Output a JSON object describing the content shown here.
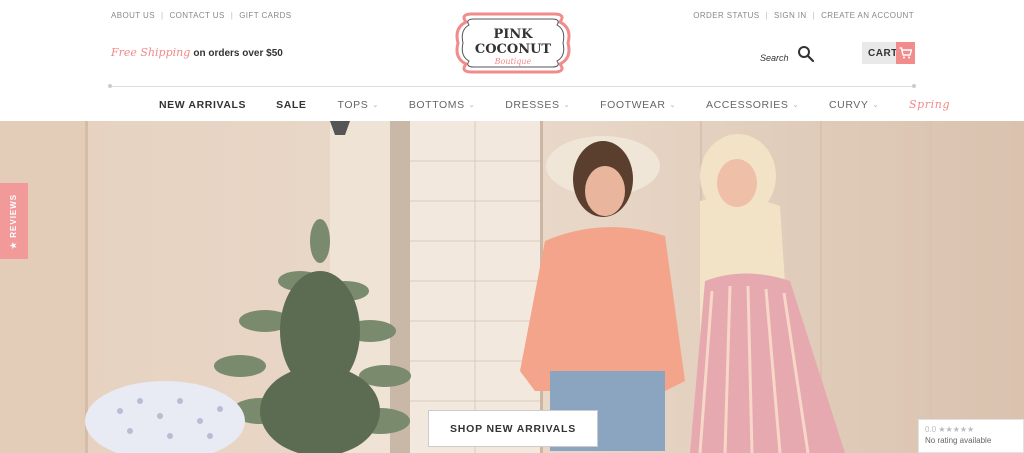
{
  "utility_left": [
    "ABOUT US",
    "CONTACT US",
    "GIFT CARDS"
  ],
  "utility_right": [
    "ORDER STATUS",
    "SIGN IN",
    "CREATE AN ACCOUNT"
  ],
  "logo": {
    "line1": "PINK",
    "line2": "COCONUT",
    "line3": "Boutique",
    "accent": "#f28b8b"
  },
  "shipping": {
    "free": "Free Shipping",
    "rest": "on orders over $50"
  },
  "search": {
    "label": "Search",
    "icon": "search-icon"
  },
  "cart": {
    "label": "CART",
    "icon": "cart-icon"
  },
  "nav": [
    {
      "label": "NEW ARRIVALS",
      "dropdown": false,
      "style": "bold"
    },
    {
      "label": "SALE",
      "dropdown": false,
      "style": "bold"
    },
    {
      "label": "TOPS",
      "dropdown": true,
      "style": "reg"
    },
    {
      "label": "BOTTOMS",
      "dropdown": true,
      "style": "reg"
    },
    {
      "label": "DRESSES",
      "dropdown": true,
      "style": "reg"
    },
    {
      "label": "FOOTWEAR",
      "dropdown": true,
      "style": "reg"
    },
    {
      "label": "ACCESSORIES",
      "dropdown": true,
      "style": "reg"
    },
    {
      "label": "CURVY",
      "dropdown": true,
      "style": "reg"
    },
    {
      "label": "Spring",
      "dropdown": false,
      "style": "spring"
    }
  ],
  "hero": {
    "cta": "SHOP NEW ARRIVALS"
  },
  "reviews_tab": "★ REVIEWS",
  "rating_badge": {
    "score": "0.0",
    "stars": "★★★★★",
    "text": "No rating available"
  }
}
